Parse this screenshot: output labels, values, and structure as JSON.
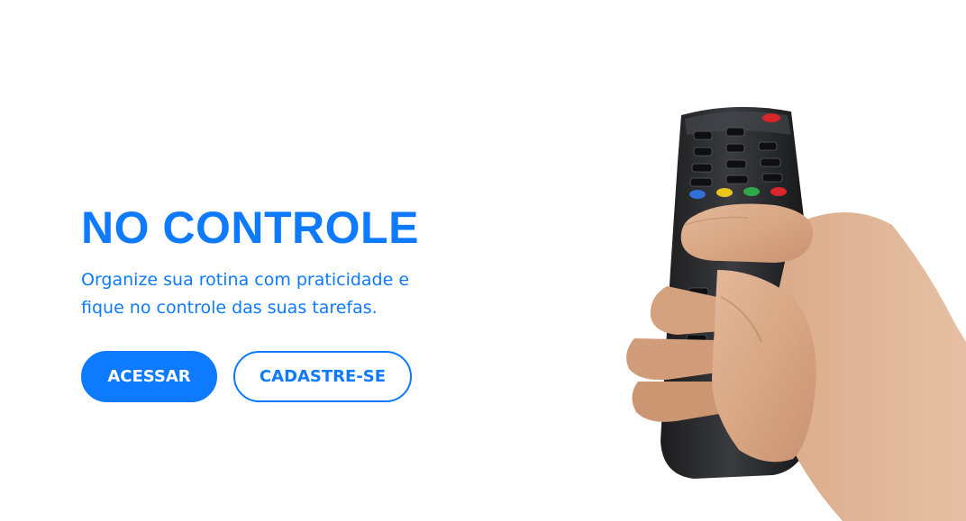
{
  "hero": {
    "title": "NO CONTROLE",
    "subtitle": "Organize sua rotina com praticidade e fique no controle das suas tarefas.",
    "primary_button": "ACESSAR",
    "secondary_button": "CADASTRE-SE",
    "image_icon": "hand-holding-remote-control-icon"
  },
  "colors": {
    "accent": "#0d7aff",
    "background": "#ffffff"
  }
}
